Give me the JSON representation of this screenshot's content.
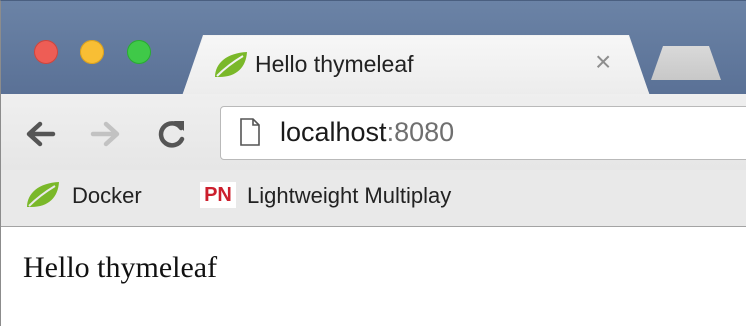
{
  "browser": {
    "tab": {
      "title": "Hello thymeleaf",
      "close_glyph": "×",
      "favicon": "leaf-icon"
    },
    "toolbar": {
      "back_icon": "back-arrow-icon",
      "forward_icon": "forward-arrow-icon",
      "reload_icon": "reload-icon",
      "address": {
        "page_icon": "page-icon",
        "host": "localhost",
        "port": ":8080"
      }
    },
    "bookmarks": [
      {
        "label": "Docker",
        "icon": "leaf-icon"
      },
      {
        "label": "Lightweight Multiplay",
        "icon_text": "PN"
      }
    ],
    "colors": {
      "close": "#ee5d55",
      "minimize": "#f8be34",
      "maximize": "#3fc948",
      "pn_red": "#cc1f2d",
      "leaf_green": "#7ab829"
    }
  },
  "page": {
    "body_text": "Hello thymeleaf"
  }
}
